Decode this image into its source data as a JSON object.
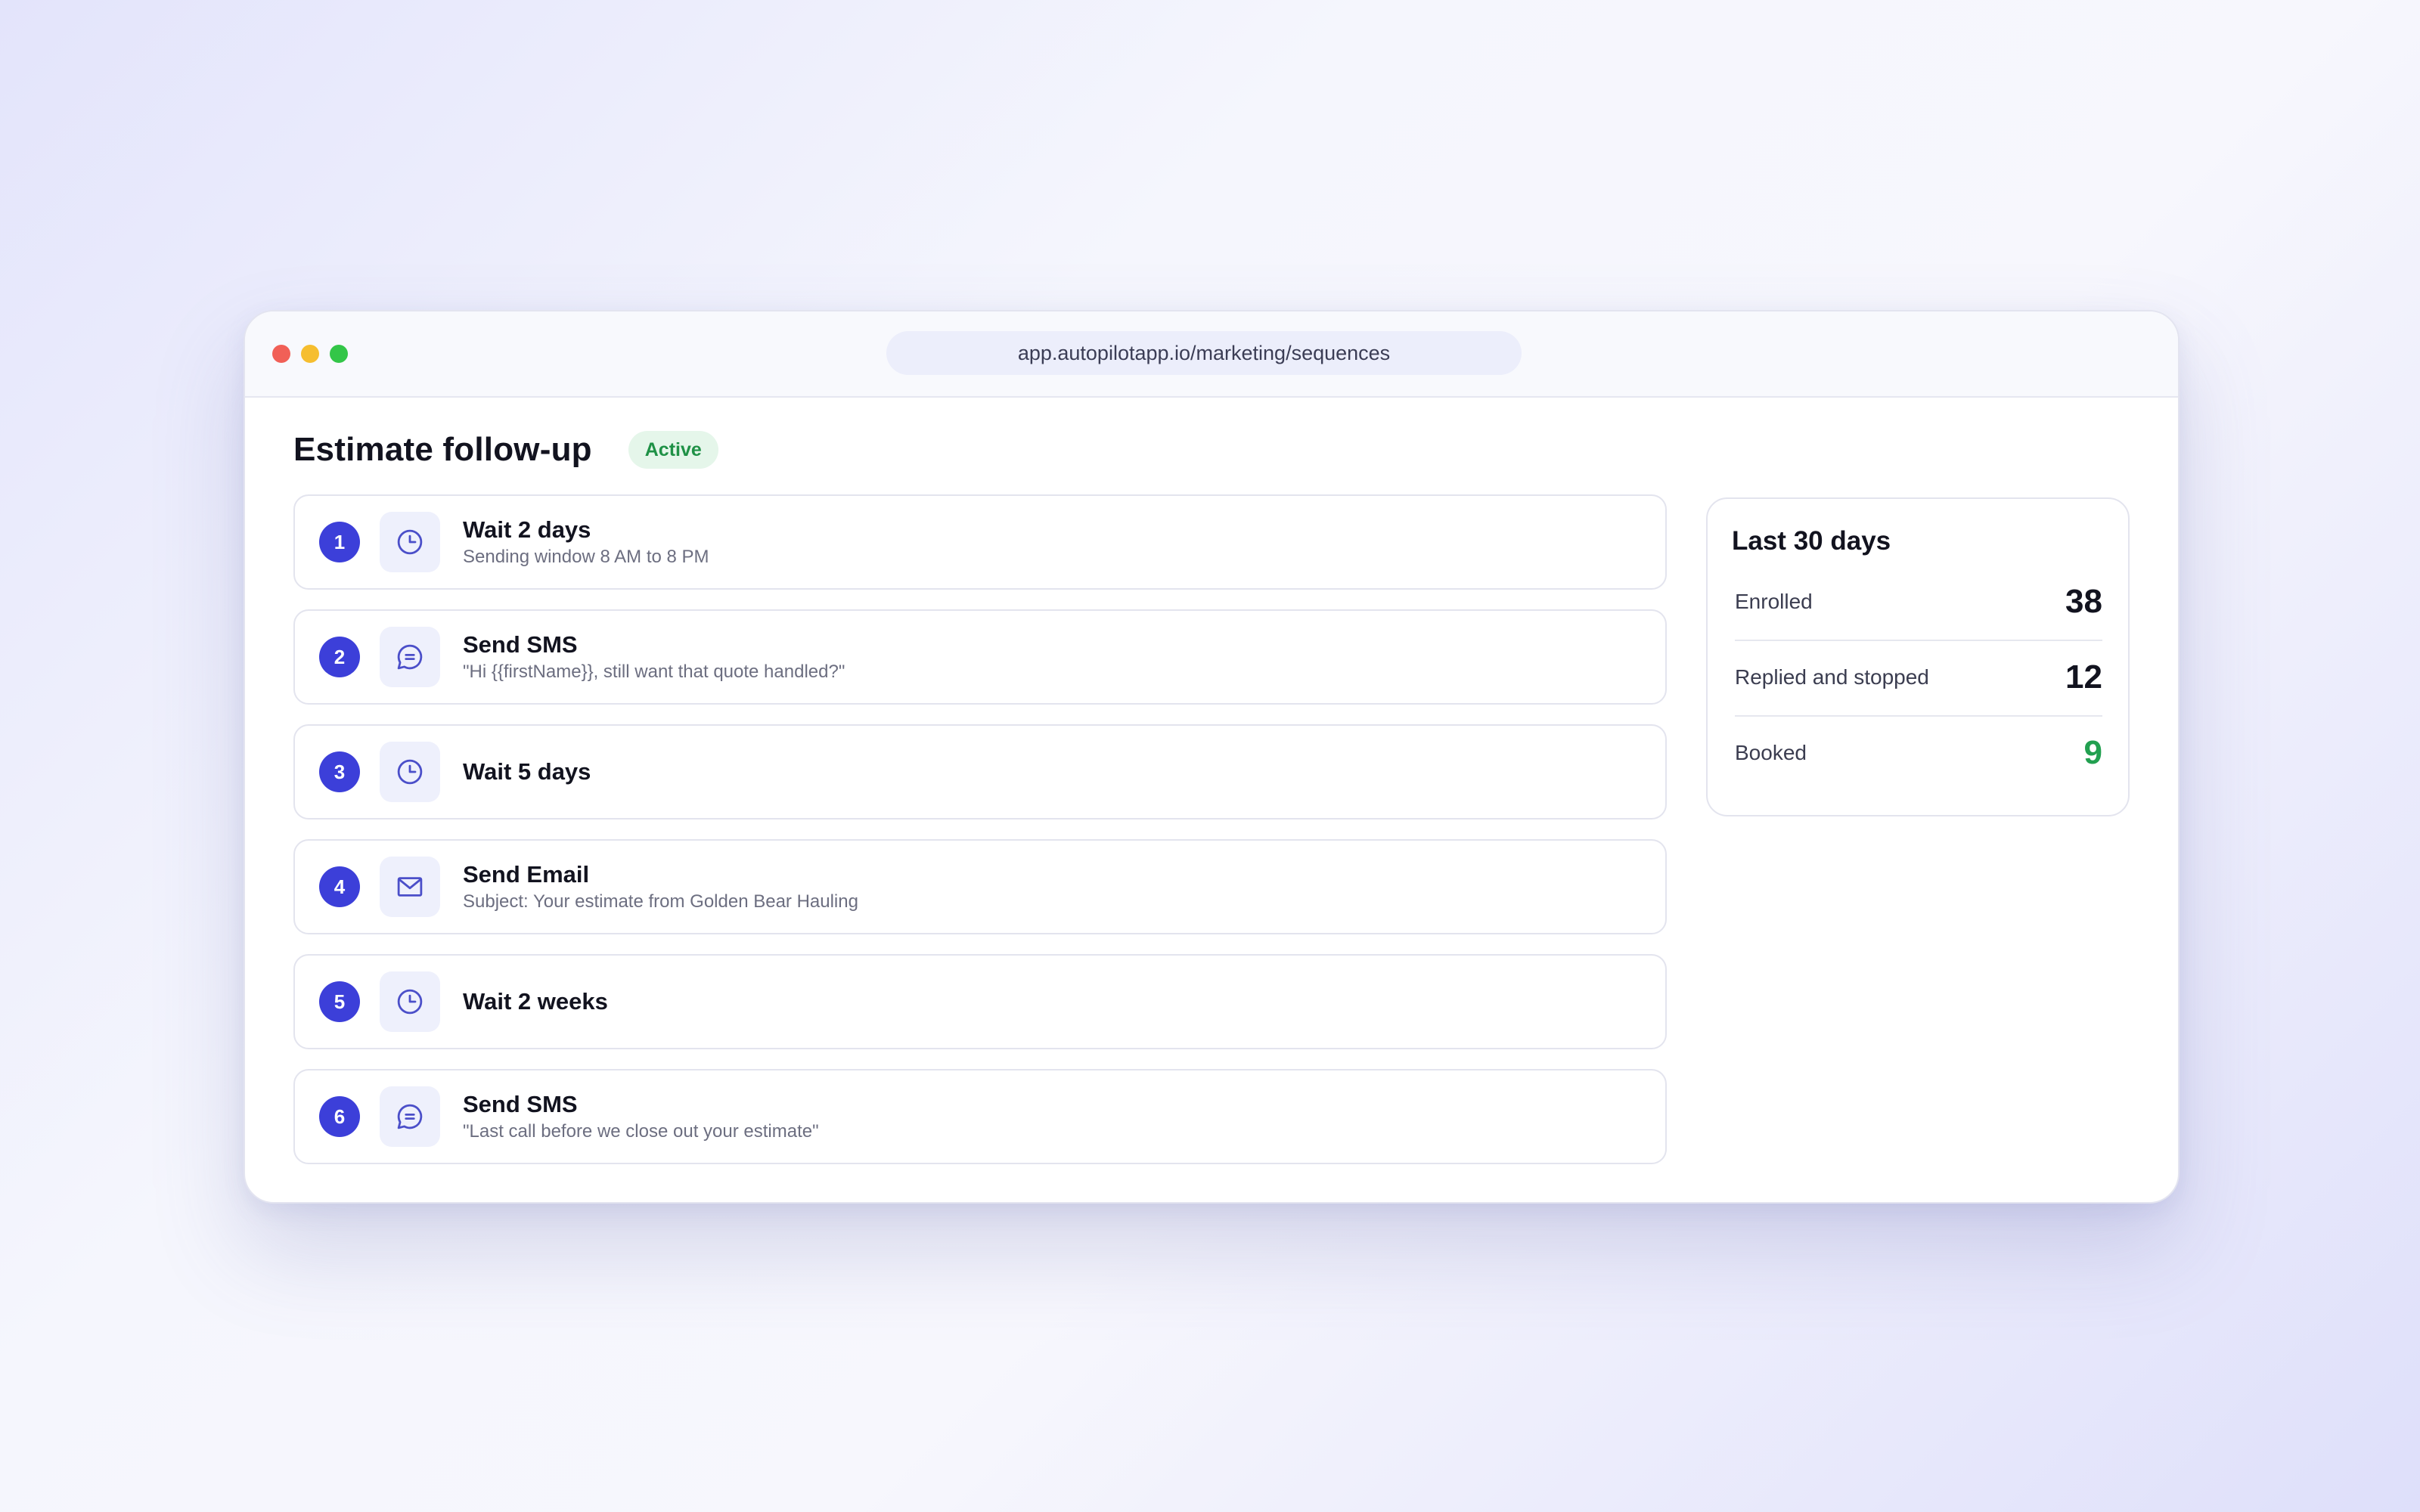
{
  "browser": {
    "url": "app.autopilotapp.io/marketing/sequences"
  },
  "header": {
    "title": "Estimate follow-up",
    "status": "Active"
  },
  "steps": [
    {
      "number": "1",
      "icon": "clock-icon",
      "title": "Wait 2 days",
      "subtitle": "Sending window 8 AM to 8 PM"
    },
    {
      "number": "2",
      "icon": "sms-icon",
      "title": "Send SMS",
      "subtitle": "\"Hi {{firstName}}, still want that quote handled?\""
    },
    {
      "number": "3",
      "icon": "clock-icon",
      "title": "Wait 5 days",
      "subtitle": ""
    },
    {
      "number": "4",
      "icon": "mail-icon",
      "title": "Send Email",
      "subtitle": "Subject: Your estimate from Golden Bear Hauling"
    },
    {
      "number": "5",
      "icon": "clock-icon",
      "title": "Wait 2 weeks",
      "subtitle": ""
    },
    {
      "number": "6",
      "icon": "sms-icon",
      "title": "Send SMS",
      "subtitle": "\"Last call before we close out your estimate\""
    }
  ],
  "stats": {
    "title": "Last 30 days",
    "rows": [
      {
        "label": "Enrolled",
        "value": "38"
      },
      {
        "label": "Replied and stopped",
        "value": "12"
      },
      {
        "label": "Booked",
        "value": "9"
      }
    ]
  },
  "colors": {
    "accent": "#3c3fd9",
    "active_badge_bg": "#e5f6ea",
    "active_badge_text": "#1f9146",
    "booked_value": "#22a050"
  }
}
